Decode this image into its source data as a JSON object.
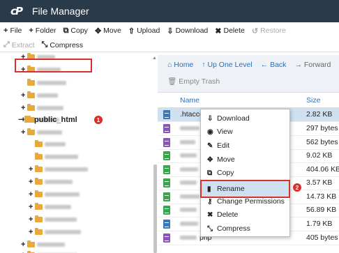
{
  "app": {
    "title": "File Manager",
    "logo": "cP"
  },
  "toolbar": {
    "file": "File",
    "folder": "Folder",
    "copy": "Copy",
    "move": "Move",
    "upload": "Upload",
    "download": "Download",
    "delete": "Delete",
    "restore": "Restore",
    "extract": "Extract",
    "compress": "Compress"
  },
  "tree": {
    "selected_label": "public_html",
    "badge": "1"
  },
  "nav": {
    "home": "Home",
    "up": "Up One Level",
    "back": "Back",
    "forward": "Forward",
    "empty_trash": "Empty Trash"
  },
  "columns": {
    "name": "Name",
    "size": "Size"
  },
  "files": [
    {
      "name": ".htacce",
      "size": "2.82 KB"
    },
    {
      "name": "",
      "size": "297 bytes"
    },
    {
      "name": "",
      "size": "562 bytes"
    },
    {
      "name": "",
      "size": "9.02 KB"
    },
    {
      "name": "",
      "size": "404.06 KB"
    },
    {
      "name": "",
      "size": "3.57 KB"
    },
    {
      "name": "",
      "size": "14.73 KB"
    },
    {
      "name": "",
      "size": "56.89 KB"
    },
    {
      "name": "",
      "size": "1.79 KB"
    },
    {
      "name": "php",
      "size": "405 bytes"
    }
  ],
  "context_menu": {
    "download": "Download",
    "view": "View",
    "edit": "Edit",
    "move": "Move",
    "copy": "Copy",
    "rename": "Rename",
    "change_permissions": "Change Permissions",
    "delete": "Delete",
    "compress": "Compress",
    "badge": "2"
  },
  "colors": {
    "header": "#293a4a",
    "accent": "#2d6fb5",
    "highlight": "#d9302c",
    "selection": "#cfe0f1"
  }
}
